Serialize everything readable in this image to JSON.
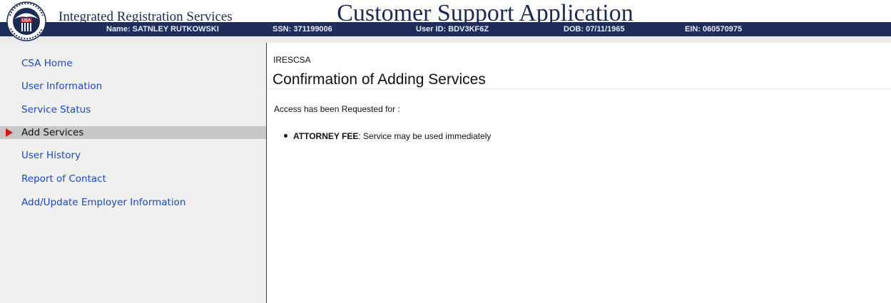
{
  "header": {
    "org_name": "Integrated Registration Services",
    "app_title": "Customer Support Application"
  },
  "infobar": {
    "name": "Name: SATNLEY RUTKOWSKI",
    "ssn": "SSN: 371199006",
    "user_id": "User ID: BDV3KF6Z",
    "dob": "DOB: 07/11/1965",
    "ein": "EIN: 060570975"
  },
  "sidebar": {
    "items": [
      {
        "label": "CSA Home"
      },
      {
        "label": "User Information"
      },
      {
        "label": "Service Status"
      },
      {
        "label": "Add Services",
        "active": true
      },
      {
        "label": "User History"
      },
      {
        "label": "Report of Contact"
      },
      {
        "label": "Add/Update Employer Information"
      }
    ]
  },
  "main": {
    "page_code": "IRESCSA",
    "page_title": "Confirmation of Adding Services",
    "access_text": "Access has been Requested for :",
    "services": [
      {
        "name": "ATTORNEY FEE",
        "status": ": Service may be used immediately"
      }
    ]
  },
  "colors": {
    "infobar_bg": "#1e2d5c",
    "link": "#1a47c8",
    "active_arrow": "#d01818",
    "title_text": "#1b2a55"
  }
}
